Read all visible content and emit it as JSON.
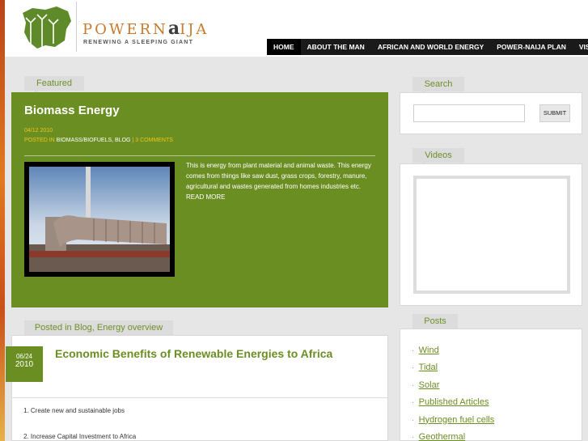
{
  "brand": {
    "left": "POWERN",
    "mid": "a",
    "right": "IJA",
    "tagline": "RENEWING A SLEEPING GIANT"
  },
  "nav": [
    "HOME",
    "ABOUT THE MAN",
    "AFRICAN AND WORLD ENERGY",
    "POWER-NAIJA PLAN",
    "VISION"
  ],
  "featured": {
    "tab": "Featured",
    "title": "Biomass Energy",
    "date": "04/12 2010",
    "posted_in_label": "POSTED IN",
    "categories": "BIOMASS/BIOFUELS, BLOG",
    "separator": "|",
    "comments": "3 COMMENTS",
    "excerpt": "This is energy from plant material and animal waste. This energy comes from things like saw dust, grass crops, forestry, manure, agricultural and wastes generated from homes industries etc. READ MORE"
  },
  "post": {
    "tab": "Posted in Blog, Energy overview",
    "month_day": "06/24",
    "year": "2010",
    "title": "Economic Benefits of Renewable Energies to Africa",
    "lines": [
      "1. Create new and sustainable jobs",
      "2. Increase Capital Investment to Africa"
    ]
  },
  "sidebar": {
    "search_tab": "Search",
    "search_placeholder": "",
    "search_button": "SUBMIT",
    "videos_tab": "Videos",
    "posts_tab": "Posts",
    "posts": [
      "Wind",
      "Tidal",
      "Solar",
      "Published Articles",
      "Hydrogen fuel cells",
      "Geothermal"
    ]
  },
  "colors": {
    "accent": "#6b8e23",
    "nav_bg": "#1a1a1a",
    "date_yellow": "#f0c419",
    "brand_orange": "#c97a2a"
  }
}
